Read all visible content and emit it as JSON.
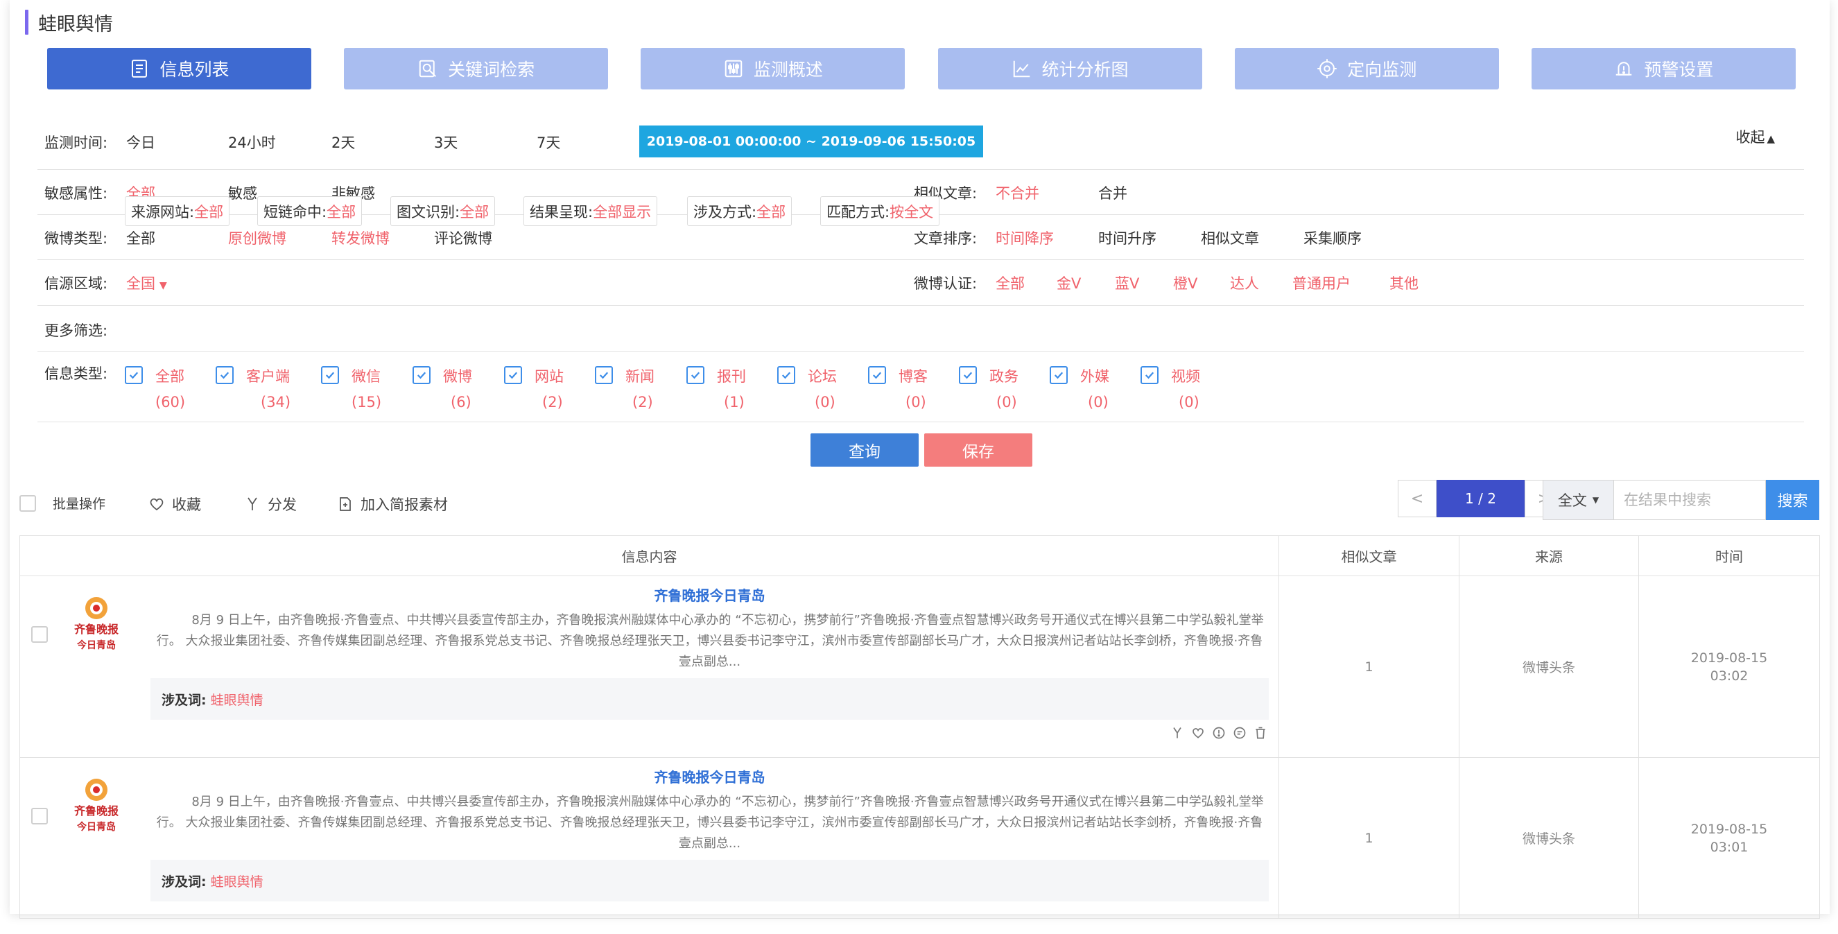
{
  "app": {
    "title": "蛙眼舆情"
  },
  "nav": [
    {
      "label": "信息列表",
      "icon": "document-list-icon",
      "active": true
    },
    {
      "label": "关键词检索",
      "icon": "search-doc-icon",
      "active": false
    },
    {
      "label": "监测概述",
      "icon": "sliders-icon",
      "active": false
    },
    {
      "label": "统计分析图",
      "icon": "line-chart-icon",
      "active": false
    },
    {
      "label": "定向监测",
      "icon": "crosshair-icon",
      "active": false
    },
    {
      "label": "预警设置",
      "icon": "alert-icon",
      "active": false
    }
  ],
  "filters": {
    "time": {
      "label": "监测时间:",
      "options": [
        "今日",
        "24小时",
        "2天",
        "3天",
        "7天"
      ],
      "range": "2019-08-01 00:00:00 ~ 2019-09-06 15:50:05",
      "collapse": "收起"
    },
    "sensitive": {
      "label": "敏感属性:",
      "options": [
        "全部",
        "敏感",
        "非敏感"
      ]
    },
    "similar": {
      "label": "相似文章:",
      "options": [
        "不合并",
        "合并"
      ]
    },
    "weibo_type": {
      "label": "微博类型:",
      "options": [
        "全部",
        "原创微博",
        "转发微博",
        "评论微博"
      ]
    },
    "sort": {
      "label": "文章排序:",
      "options": [
        "时间降序",
        "时间升序",
        "相似文章",
        "采集顺序"
      ]
    },
    "region": {
      "label": "信源区域:",
      "value": "全国"
    },
    "weibo_auth": {
      "label": "微博认证:",
      "options": [
        "全部",
        "金V",
        "蓝V",
        "橙V",
        "达人",
        "普通用户",
        "其他"
      ]
    },
    "more": {
      "label": "更多筛选:",
      "pills": [
        {
          "name": "来源网站:",
          "value": "全部"
        },
        {
          "name": "短链命中:",
          "value": "全部"
        },
        {
          "name": "图文识别:",
          "value": "全部"
        },
        {
          "name": "结果呈现:",
          "value": "全部显示"
        },
        {
          "name": "涉及方式:",
          "value": "全部"
        },
        {
          "name": "匹配方式:",
          "value": "按全文"
        }
      ]
    },
    "info_type": {
      "label": "信息类型:",
      "items": [
        {
          "label": "全部",
          "count": "(60)"
        },
        {
          "label": "客户端",
          "count": "(34)"
        },
        {
          "label": "微信",
          "count": "(15)"
        },
        {
          "label": "微博",
          "count": "(6)"
        },
        {
          "label": "网站",
          "count": "(2)"
        },
        {
          "label": "新闻",
          "count": "(2)"
        },
        {
          "label": "报刊",
          "count": "(1)"
        },
        {
          "label": "论坛",
          "count": "(0)"
        },
        {
          "label": "博客",
          "count": "(0)"
        },
        {
          "label": "政务",
          "count": "(0)"
        },
        {
          "label": "外媒",
          "count": "(0)"
        },
        {
          "label": "视频",
          "count": "(0)"
        }
      ]
    }
  },
  "actions": {
    "query": "查询",
    "save": "保存"
  },
  "toolbar": {
    "batch": "批量操作",
    "favorite": "收藏",
    "distribute": "分发",
    "add_report": "加入简报素材"
  },
  "pager": {
    "prev": "<",
    "current": "1 / 2",
    "next": ">"
  },
  "search": {
    "scope": "全文",
    "placeholder": "在结果中搜索",
    "button": "搜索"
  },
  "table": {
    "headers": [
      "信息内容",
      "相似文章",
      "来源",
      "时间"
    ],
    "rows": [
      {
        "source_title": "齐鲁晚报今日青岛",
        "excerpt": "8月 9 日上午，由齐鲁晚报·齐鲁壹点、中共博兴县委宣传部主办，齐鲁晚报滨州融媒体中心承办的 “不忘初心，携梦前行”齐鲁晚报·齐鲁壹点智慧博兴政务号开通仪式在博兴县第二中学弘毅礼堂举行。         大众报业集团社委、齐鲁传媒集团副总经理、齐鲁报系党总支书记、齐鲁晚报总经理张天卫，博兴县委书记李守江，滨州市委宣传部副部长马广才，大众日报滨州记者站站长李剑桥，齐鲁晚报·齐鲁壹点副总...",
        "kw_label": "涉及词:",
        "kw": "蛙眼舆情",
        "similar": "1",
        "source": "微博头条",
        "date": "2019-08-15",
        "time": "03:02"
      },
      {
        "source_title": "齐鲁晚报今日青岛",
        "excerpt": "8月 9 日上午，由齐鲁晚报·齐鲁壹点、中共博兴县委宣传部主办，齐鲁晚报滨州融媒体中心承办的 “不忘初心，携梦前行”齐鲁晚报·齐鲁壹点智慧博兴政务号开通仪式在博兴县第二中学弘毅礼堂举行。         大众报业集团社委、齐鲁传媒集团副总经理、齐鲁报系党总支书记、齐鲁晚报总经理张天卫，博兴县委书记李守江，滨州市委宣传部副部长马广才，大众日报滨州记者站站长李剑桥，齐鲁晚报·齐鲁壹点副总...",
        "kw_label": "涉及词:",
        "kw": "蛙眼舆情",
        "similar": "1",
        "source": "微博头条",
        "date": "2019-08-15",
        "time": "03:01"
      }
    ]
  },
  "colors": {
    "primary": "#3e6ad1",
    "nav_inactive": "#a9bdf0",
    "accent_red": "#f0626b",
    "date_blue": "#1ea6e0",
    "save_red": "#f47d7d",
    "query_blue": "#3e80d8"
  }
}
